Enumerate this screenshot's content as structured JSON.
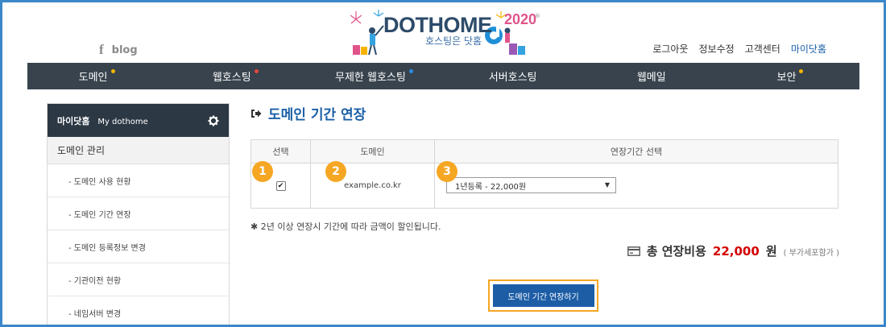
{
  "header": {
    "social": {
      "facebook_icon": "f",
      "blog_label": "blog"
    },
    "logo": {
      "text": "DOTHOME",
      "year": "2020",
      "tagline": "호스팅은 닷홈"
    },
    "top_links": [
      "로그아웃",
      "정보수정",
      "고객센터",
      "마이닷홈"
    ]
  },
  "nav": {
    "items": [
      {
        "label": "도메인",
        "dot": "#f5b400"
      },
      {
        "label": "웹호스팅",
        "dot": "#e8453c"
      },
      {
        "label": "무제한 웹호스팅",
        "dot": "#2b8de3"
      },
      {
        "label": "서버호스팅",
        "dot": ""
      },
      {
        "label": "웹메일",
        "dot": ""
      },
      {
        "label": "보안",
        "dot": "#f5b400"
      }
    ]
  },
  "sidebar": {
    "title": "마이닷홈",
    "subtitle": "My dothome",
    "group": "도메인 관리",
    "items": [
      "- 도메인 사용 현황",
      "- 도메인 기간 연장",
      "- 도메인 등록정보 변경",
      "- 기관이전 현황",
      "- 네임서버 변경"
    ]
  },
  "main": {
    "title": "도메인 기간 연장",
    "table": {
      "headers": [
        "선택",
        "도메인",
        "연장기간 선택"
      ],
      "row": {
        "checked": "✔",
        "domain": "example.co.kr",
        "period": "1년등록 - 22,000원"
      }
    },
    "badges": [
      "1",
      "2",
      "3"
    ],
    "note": "2년 이상 연장시 기간에 따라 금액이 할인됩니다.",
    "note_mark": "✱",
    "total": {
      "label": "총 연장비용",
      "amount": "22,000",
      "unit": "원",
      "vat": "( 부가세포함가 )"
    },
    "cta_label": "도메인 기간 연장하기"
  },
  "colors": {
    "accent": "#1b5fa6",
    "nav_bg": "#38434d",
    "badge": "#f5a623",
    "price": "#d40000"
  }
}
